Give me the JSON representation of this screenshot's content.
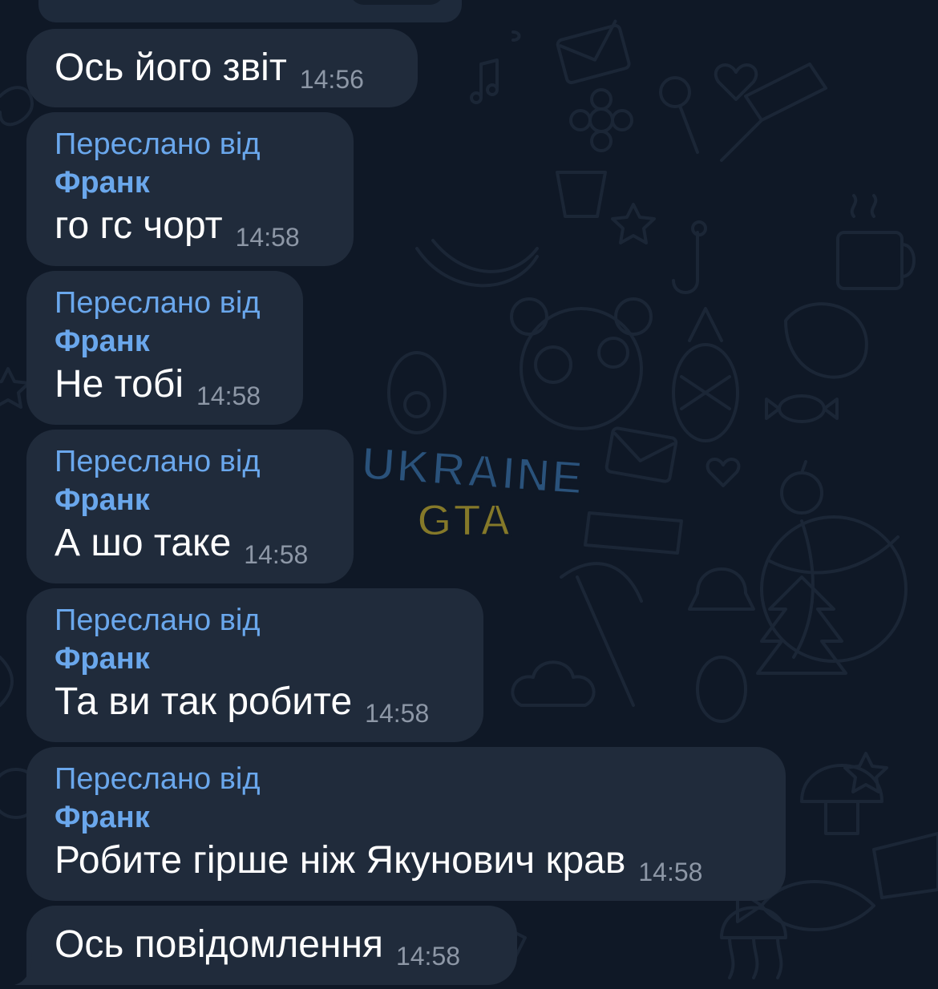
{
  "chat": {
    "messages": [
      {
        "forwarded": false,
        "text": "Ось його звіт",
        "time": "14:56"
      },
      {
        "forwarded": true,
        "forward_label": "Переслано від",
        "forward_name": "Франк",
        "text": "го гс чорт",
        "time": "14:58"
      },
      {
        "forwarded": true,
        "forward_label": "Переслано від",
        "forward_name": "Франк",
        "text": "Не тобі",
        "time": "14:58"
      },
      {
        "forwarded": true,
        "forward_label": "Переслано від",
        "forward_name": "Франк",
        "text": "А шо таке",
        "time": "14:58"
      },
      {
        "forwarded": true,
        "forward_label": "Переслано від",
        "forward_name": "Франк",
        "text": "Та ви так робите",
        "time": "14:58"
      },
      {
        "forwarded": true,
        "forward_label": "Переслано від",
        "forward_name": "Франк",
        "text": "Робите гірше ніж Якунович крав",
        "time": "14:58"
      },
      {
        "forwarded": false,
        "text": "Ось повідомлення",
        "time": "14:58"
      }
    ]
  },
  "watermark": {
    "line1": "UKRAINE",
    "line2": "GTA"
  },
  "colors": {
    "background": "#0f1826",
    "bubble": "#202b3b",
    "accent": "#6aa7ec",
    "time": "#8d97a6",
    "text": "#ffffff"
  }
}
